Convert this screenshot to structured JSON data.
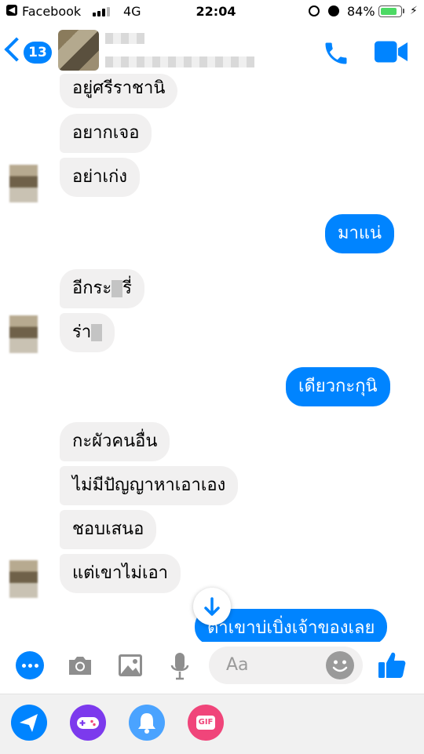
{
  "status_bar": {
    "back_app": "Facebook",
    "carrier": "4G",
    "time": "22:04",
    "battery": "84%",
    "battery_level": 0.84
  },
  "header": {
    "back_count": "13",
    "accent_color": "#0084ff"
  },
  "messages": [
    {
      "side": "in",
      "text": "อยู่ศรีราชานิ"
    },
    {
      "side": "in",
      "text": "อยากเจอ"
    },
    {
      "side": "in",
      "text": "อย่าเก่ง"
    },
    {
      "side": "out",
      "text": "มาแน่"
    },
    {
      "side": "in",
      "text": "อีกระ"
    },
    {
      "side": "in",
      "text": "รี่",
      "note": "part of censored word"
    },
    {
      "side": "in",
      "text": "ร่า"
    },
    {
      "side": "out",
      "text": "เดียวกะกุนิ"
    },
    {
      "side": "in",
      "text": "กะผัวคนอื่น"
    },
    {
      "side": "in",
      "text": "ไม่มีปัญญาหาเอาเอง"
    },
    {
      "side": "in",
      "text": "ชอบเสนอ"
    },
    {
      "side": "in",
      "text": "แต่เขาไม่เอา"
    },
    {
      "side": "out",
      "text": "ตาเขาบ่เบิ่งเจ้าของเลย"
    }
  ],
  "composer": {
    "placeholder": "Aa"
  },
  "tray": {
    "gif_label": "GIF",
    "colors": {
      "send": "#0084ff",
      "game": "#7c3aed",
      "bell": "#4aa3ff",
      "gif": "#f0457a"
    }
  }
}
